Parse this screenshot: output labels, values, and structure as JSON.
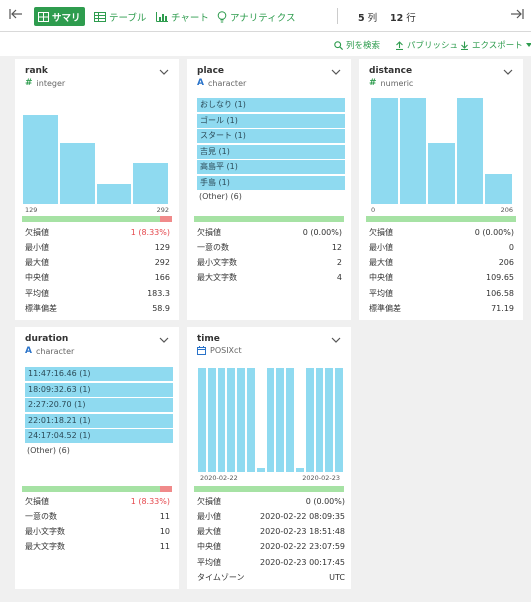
{
  "toolbar": {
    "tabs": [
      {
        "label": "サマリ",
        "icon": "summary-icon",
        "active": true
      },
      {
        "label": "テーブル",
        "icon": "table-icon",
        "active": false
      },
      {
        "label": "チャート",
        "icon": "chart-icon",
        "active": false
      },
      {
        "label": "アナリティクス",
        "icon": "bulb-icon",
        "active": false
      }
    ],
    "columns_num": "5",
    "columns_unit": "列",
    "rows_num": "12",
    "rows_unit": "行"
  },
  "actions": {
    "search": "列を検索",
    "publish": "パブリッシュ",
    "export": "エクスポート"
  },
  "colors": {
    "accent": "#2e9c4e",
    "bar": "#8fdaf0",
    "complete": "#a6e2a4",
    "missing": "#f08a8a",
    "missing_text": "#e5484d"
  },
  "cards": {
    "rank": {
      "title": "rank",
      "type": "integer",
      "hist": [
        0.8,
        0.55,
        0.18,
        0.37
      ],
      "axis_min": "129",
      "axis_max": "292",
      "missing_fraction": 0.0833,
      "stats": [
        {
          "label": "欠損値",
          "value": "1 (8.33%)"
        },
        {
          "label": "最小値",
          "value": "129"
        },
        {
          "label": "最大値",
          "value": "292"
        },
        {
          "label": "中央値",
          "value": "166"
        },
        {
          "label": "平均値",
          "value": "183.3"
        },
        {
          "label": "標準偏差",
          "value": "58.9"
        }
      ]
    },
    "place": {
      "title": "place",
      "type": "character",
      "categories": [
        "おしなり (1)",
        "ゴール (1)",
        "スタート (1)",
        "吉見 (1)",
        "高島平 (1)",
        "手島 (1)"
      ],
      "other": "(Other) (6)",
      "missing_fraction": 0,
      "stats": [
        {
          "label": "欠損値",
          "value": "0 (0.00%)"
        },
        {
          "label": "一意の数",
          "value": "12"
        },
        {
          "label": "最小文字数",
          "value": "2"
        },
        {
          "label": "最大文字数",
          "value": "4"
        }
      ]
    },
    "distance": {
      "title": "distance",
      "type": "numeric",
      "hist": [
        1.0,
        1.0,
        0.58,
        1.0,
        0.28
      ],
      "axis_min": "0",
      "axis_max": "206",
      "missing_fraction": 0,
      "stats": [
        {
          "label": "欠損値",
          "value": "0 (0.00%)"
        },
        {
          "label": "最小値",
          "value": "0"
        },
        {
          "label": "最大値",
          "value": "206"
        },
        {
          "label": "中央値",
          "value": "109.65"
        },
        {
          "label": "平均値",
          "value": "106.58"
        },
        {
          "label": "標準偏差",
          "value": "71.19"
        }
      ]
    },
    "duration": {
      "title": "duration",
      "type": "character",
      "categories": [
        "11:47:16.46 (1)",
        "18:09:32.63 (1)",
        "2:27:20.70 (1)",
        "22:01:18.21 (1)",
        "24:17:04.52 (1)"
      ],
      "other": "(Other) (6)",
      "missing_fraction": 0.0833,
      "stats": [
        {
          "label": "欠損値",
          "value": "1 (8.33%)"
        },
        {
          "label": "一意の数",
          "value": "11"
        },
        {
          "label": "最小文字数",
          "value": "10"
        },
        {
          "label": "最大文字数",
          "value": "11"
        }
      ]
    },
    "time": {
      "title": "time",
      "type": "POSIXct",
      "hist": [
        1,
        1,
        1,
        1,
        1,
        1,
        0.04,
        1,
        1,
        1,
        0.04,
        1,
        1,
        1,
        1
      ],
      "axis_min": "2020-02-22",
      "axis_max": "2020-02-23",
      "missing_fraction": 0,
      "stats": [
        {
          "label": "欠損値",
          "value": "0 (0.00%)"
        },
        {
          "label": "最小値",
          "value": "2020-02-22 08:09:35"
        },
        {
          "label": "最大値",
          "value": "2020-02-23 18:51:48"
        },
        {
          "label": "中央値",
          "value": "2020-02-22 23:07:59"
        },
        {
          "label": "平均値",
          "value": "2020-02-23 00:17:45"
        },
        {
          "label": "タイムゾーン",
          "value": "UTC"
        }
      ]
    }
  }
}
